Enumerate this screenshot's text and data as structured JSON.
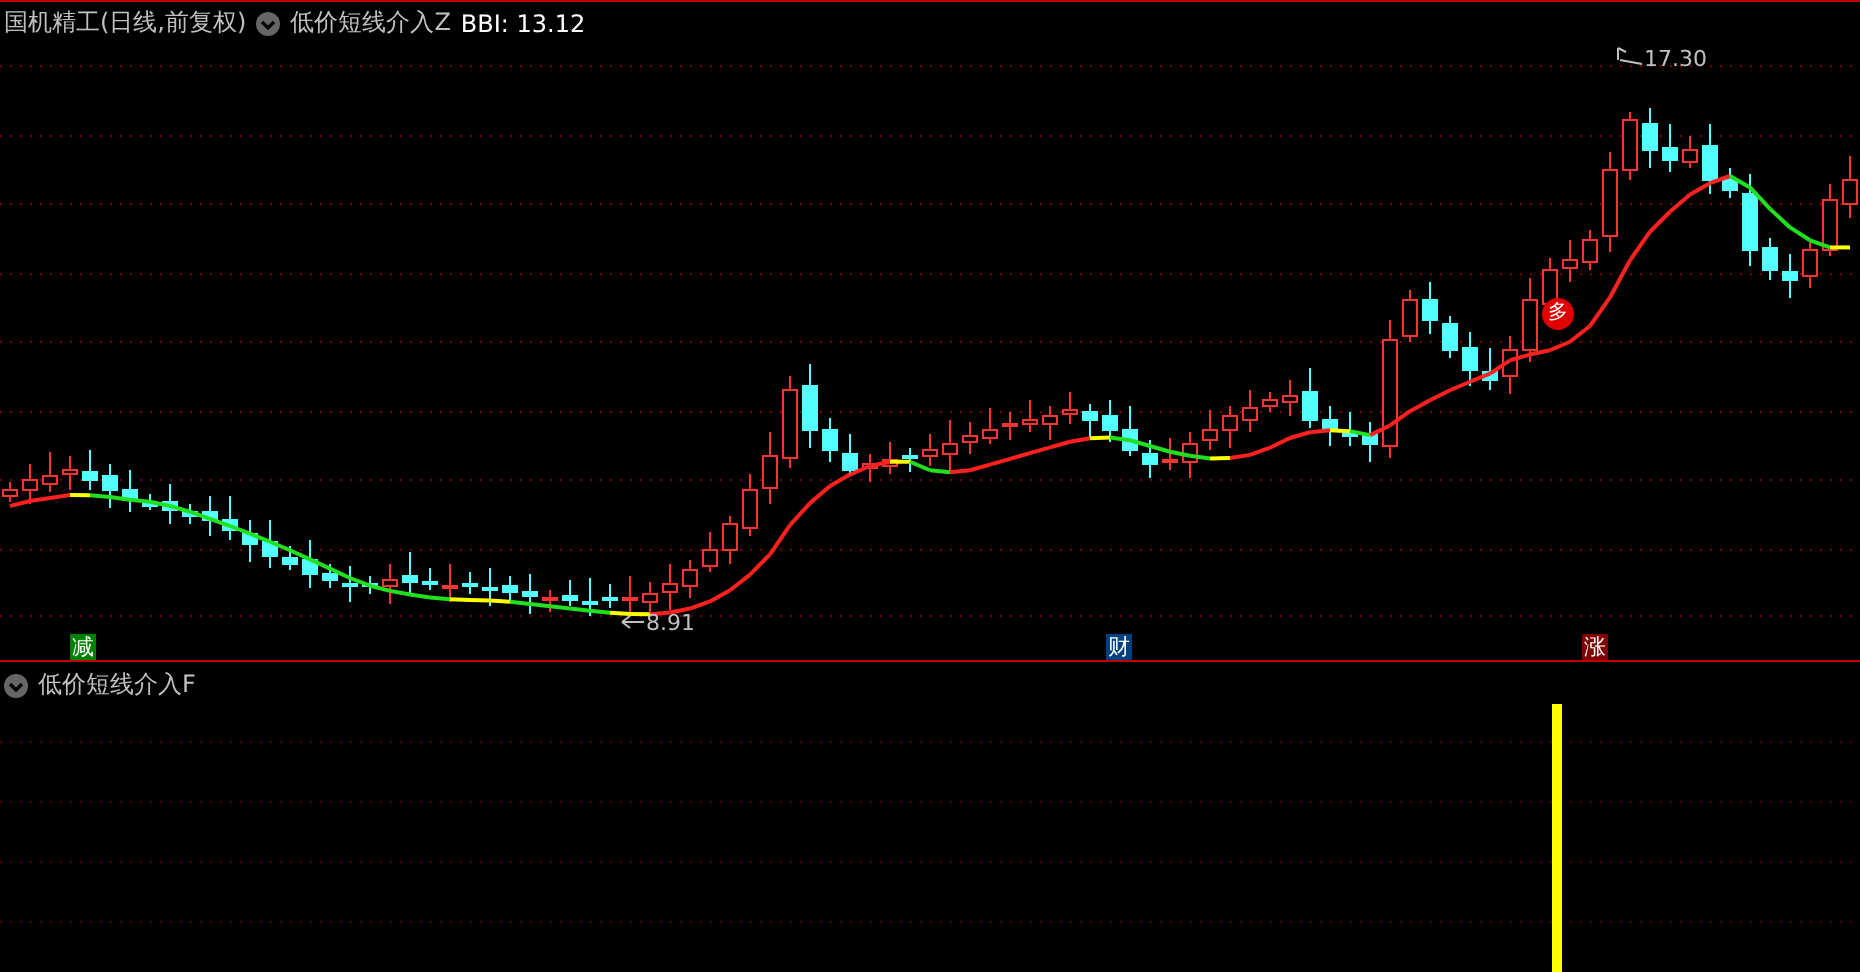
{
  "main_panel": {
    "title": "国机精工(日线,前复权)",
    "indicator": "低价短线介入Z",
    "reading": "BBI: 13.12",
    "high_label": "17.30",
    "low_label": "8.91",
    "signal": "多",
    "events": [
      {
        "label": "减",
        "color": "#008000"
      },
      {
        "label": "财",
        "color": "#004080"
      },
      {
        "label": "涨",
        "color": "#800000"
      }
    ]
  },
  "sub_panel": {
    "indicator": "低价短线介入F"
  }
}
